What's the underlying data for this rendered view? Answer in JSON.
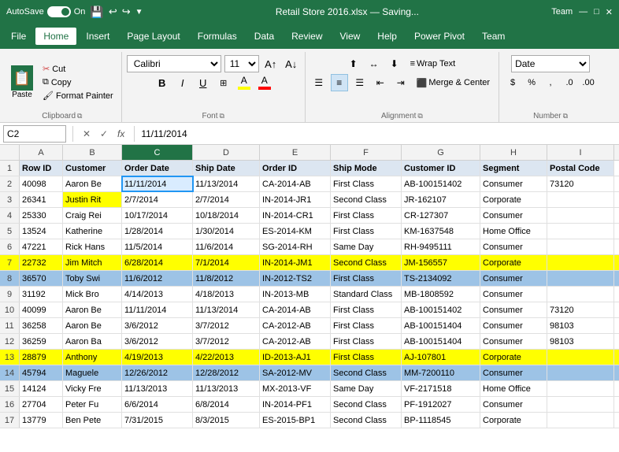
{
  "titleBar": {
    "autosave": "AutoSave",
    "toggleState": "On",
    "filename": "Retail Store 2016.xlsx — Saving...",
    "teamLabel": "Team"
  },
  "menuBar": {
    "items": [
      "File",
      "Home",
      "Insert",
      "Page Layout",
      "Formulas",
      "Data",
      "Review",
      "View",
      "Help",
      "Power Pivot",
      "Team"
    ]
  },
  "ribbon": {
    "clipboard": {
      "paste": "Paste",
      "cut": "Cut",
      "copy": "Copy",
      "formatPainter": "Format Painter",
      "label": "Clipboard"
    },
    "font": {
      "fontName": "Calibri",
      "fontSize": "11",
      "label": "Font"
    },
    "alignment": {
      "wrapText": "Wrap Text",
      "mergeCenter": "Merge & Center",
      "label": "Alignment"
    },
    "number": {
      "format": "Date",
      "label": "Number"
    }
  },
  "formulaBar": {
    "nameBox": "C2",
    "formula": "11/11/2014"
  },
  "columns": {
    "headers": [
      "A",
      "B",
      "C",
      "D",
      "E",
      "F",
      "G",
      "H",
      "I"
    ],
    "widths": [
      55,
      75,
      90,
      85,
      90,
      90,
      100,
      85,
      85
    ]
  },
  "rows": [
    {
      "num": 1,
      "isHeader": true,
      "cells": [
        "Row ID",
        "Customer",
        "Order Date",
        "Ship Date",
        "Order ID",
        "Ship Mode",
        "Customer ID",
        "Segment",
        "Postal Code"
      ]
    },
    {
      "num": 2,
      "isSelected": false,
      "isBSelected": true,
      "cells": [
        "40098",
        "Aaron Be",
        "11/11/2014",
        "11/13/2014",
        "CA-2014-AB",
        "First Class",
        "AB-100151402",
        "Consumer",
        "73120"
      ]
    },
    {
      "num": 3,
      "isBYellow": true,
      "cells": [
        "26341",
        "Justin Rit",
        "2/7/2014",
        "2/7/2014",
        "IN-2014-JR1",
        "Second Class",
        "JR-162107",
        "Corporate",
        ""
      ]
    },
    {
      "num": 4,
      "cells": [
        "25330",
        "Craig Rei",
        "10/17/2014",
        "10/18/2014",
        "IN-2014-CR1",
        "First Class",
        "CR-127307",
        "Consumer",
        ""
      ]
    },
    {
      "num": 5,
      "cells": [
        "13524",
        "Katherine",
        "1/28/2014",
        "1/30/2014",
        "ES-2014-KM",
        "First Class",
        "KM-1637548",
        "Home Office",
        ""
      ]
    },
    {
      "num": 6,
      "cells": [
        "47221",
        "Rick Hans",
        "11/5/2014",
        "11/6/2014",
        "SG-2014-RH",
        "Same Day",
        "RH-9495111",
        "Consumer",
        ""
      ]
    },
    {
      "num": 7,
      "isYellow": true,
      "cells": [
        "22732",
        "Jim Mitch",
        "6/28/2014",
        "7/1/2014",
        "IN-2014-JM1",
        "Second Class",
        "JM-156557",
        "Corporate",
        ""
      ]
    },
    {
      "num": 8,
      "isBlue": true,
      "cells": [
        "36570",
        "Toby Swi",
        "11/6/2012",
        "11/8/2012",
        "IN-2012-TS2",
        "First Class",
        "TS-2134092",
        "Consumer",
        ""
      ]
    },
    {
      "num": 9,
      "cells": [
        "31192",
        "Mick Bro",
        "4/14/2013",
        "4/18/2013",
        "IN-2013-MB",
        "Standard Class",
        "MB-1808592",
        "Consumer",
        ""
      ]
    },
    {
      "num": 10,
      "cells": [
        "40099",
        "Aaron Be",
        "11/11/2014",
        "11/13/2014",
        "CA-2014-AB",
        "First Class",
        "AB-100151402",
        "Consumer",
        "73120"
      ]
    },
    {
      "num": 11,
      "cells": [
        "36258",
        "Aaron Be",
        "3/6/2012",
        "3/7/2012",
        "CA-2012-AB",
        "First Class",
        "AB-100151404",
        "Consumer",
        "98103"
      ]
    },
    {
      "num": 12,
      "cells": [
        "36259",
        "Aaron Ba",
        "3/6/2012",
        "3/7/2012",
        "CA-2012-AB",
        "First Class",
        "AB-100151404",
        "Consumer",
        "98103"
      ]
    },
    {
      "num": 13,
      "isYellow": true,
      "cells": [
        "28879",
        "Anthony",
        "4/19/2013",
        "4/22/2013",
        "ID-2013-AJ1",
        "First Class",
        "AJ-107801",
        "Corporate",
        ""
      ]
    },
    {
      "num": 14,
      "isBlue": true,
      "cells": [
        "45794",
        "Maguele",
        "12/26/2012",
        "12/28/2012",
        "SA-2012-MV",
        "Second Class",
        "MM-7200110",
        "Consumer",
        ""
      ]
    },
    {
      "num": 15,
      "cells": [
        "14124",
        "Vicky Fre",
        "11/13/2013",
        "11/13/2013",
        "MX-2013-VF",
        "Same Day",
        "VF-2171518",
        "Home Office",
        ""
      ]
    },
    {
      "num": 16,
      "cells": [
        "27704",
        "Peter Fu",
        "6/6/2014",
        "6/8/2014",
        "IN-2014-PF1",
        "Second Class",
        "PF-1912027",
        "Consumer",
        ""
      ]
    },
    {
      "num": 17,
      "cells": [
        "13779",
        "Ben Pete",
        "7/31/2015",
        "8/3/2015",
        "ES-2015-BP1",
        "Second Class",
        "BP-1118545",
        "Corporate",
        ""
      ]
    }
  ]
}
